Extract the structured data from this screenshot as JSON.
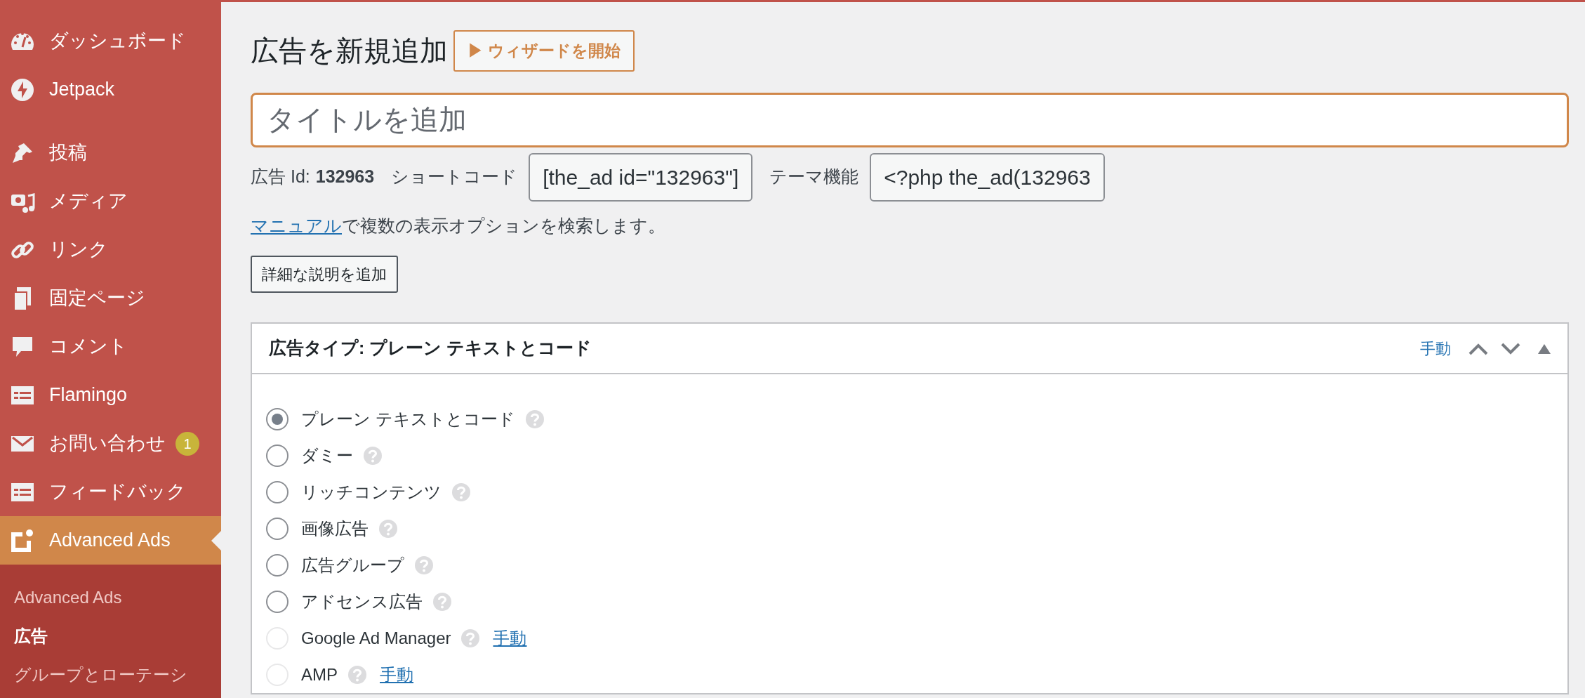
{
  "sidebar": {
    "items": [
      {
        "kind": "menu",
        "label": "ダッシュボード",
        "selected": false
      },
      {
        "kind": "menu",
        "label": "Jetpack",
        "selected": false
      },
      {
        "kind": "separator"
      },
      {
        "kind": "menu",
        "label": "投稿",
        "selected": false
      },
      {
        "kind": "menu",
        "label": "メディア",
        "selected": false
      },
      {
        "kind": "menu",
        "label": "リンク",
        "selected": false
      },
      {
        "kind": "menu",
        "label": "固定ページ",
        "selected": false
      },
      {
        "kind": "menu",
        "label": "コメント",
        "selected": false
      },
      {
        "kind": "menu",
        "label": "Flamingo",
        "selected": false
      },
      {
        "kind": "menu",
        "label": "お問い合わせ",
        "selected": false,
        "badge": "1"
      },
      {
        "kind": "menu",
        "label": "フィードバック",
        "selected": false
      },
      {
        "kind": "menu",
        "label": "Advanced Ads",
        "selected": true
      }
    ],
    "submenu": [
      {
        "label": "Advanced Ads",
        "selected": false
      },
      {
        "label": "広告",
        "selected": true
      },
      {
        "label": "グループとローテーシ",
        "selected": false
      }
    ]
  },
  "page_title": "広告を新規追加",
  "wizard_button": "▶ ウィザードを開始",
  "title_field": {
    "placeholder": "タイトルを追加"
  },
  "ad_meta": {
    "id_label": "広告 Id:",
    "id_value": "132963",
    "shortcode_label": "ショートコード",
    "shortcode_value": "[the_ad id=\"132963\"]",
    "theme_label": "テーマ機能",
    "theme_value": "<?php the_ad(132963"
  },
  "manual_hint": {
    "link": "マニュアル",
    "text": "で複数の表示オプションを検索します。"
  },
  "description_button": "詳細な説明を追加",
  "ad_type_box": {
    "title": "広告タイプ: プレーン テキストとコード",
    "manual_link": "手動",
    "options": [
      {
        "label": "プレーン テキストとコード",
        "selected": true,
        "disabled": false
      },
      {
        "label": "ダミー",
        "selected": false,
        "disabled": false
      },
      {
        "label": "リッチコンテンツ",
        "selected": false,
        "disabled": false
      },
      {
        "label": "画像広告",
        "selected": false,
        "disabled": false
      },
      {
        "label": "広告グループ",
        "selected": false,
        "disabled": false
      },
      {
        "label": "アドセンス広告",
        "selected": false,
        "disabled": false
      },
      {
        "label": "Google Ad Manager",
        "selected": false,
        "disabled": true,
        "link": "手動"
      },
      {
        "label": "AMP",
        "selected": false,
        "disabled": true,
        "link": "手動"
      }
    ]
  }
}
